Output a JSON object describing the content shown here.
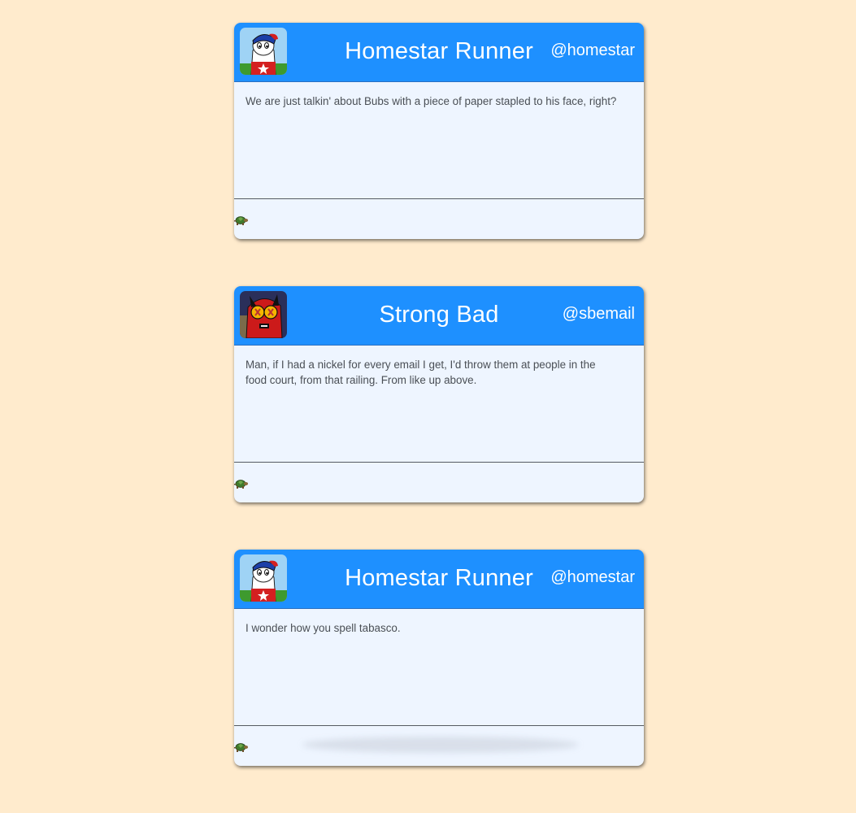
{
  "posts": [
    {
      "author": "Homestar Runner",
      "handle": "@homestar",
      "avatar": "homestar-avatar",
      "text": "We are just talkin' about Bubs with a piece of paper stapled to his face, right?",
      "footer_icon": "turtle-icon"
    },
    {
      "author": "Strong Bad",
      "handle": "@sbemail",
      "avatar": "strongbad-avatar",
      "text": "Man, if I had a nickel for every email I get, I'd throw them at people in the food court, from that railing. From like up above.",
      "footer_icon": "turtle-icon"
    },
    {
      "author": "Homestar Runner",
      "handle": "@homestar",
      "avatar": "homestar-avatar",
      "text": "I wonder how you spell tabasco.",
      "footer_icon": "turtle-icon"
    }
  ],
  "colors": {
    "background": "#ffebcd",
    "header": "#1e90ff",
    "body": "#eef5ff",
    "text": "#4a4f55"
  }
}
